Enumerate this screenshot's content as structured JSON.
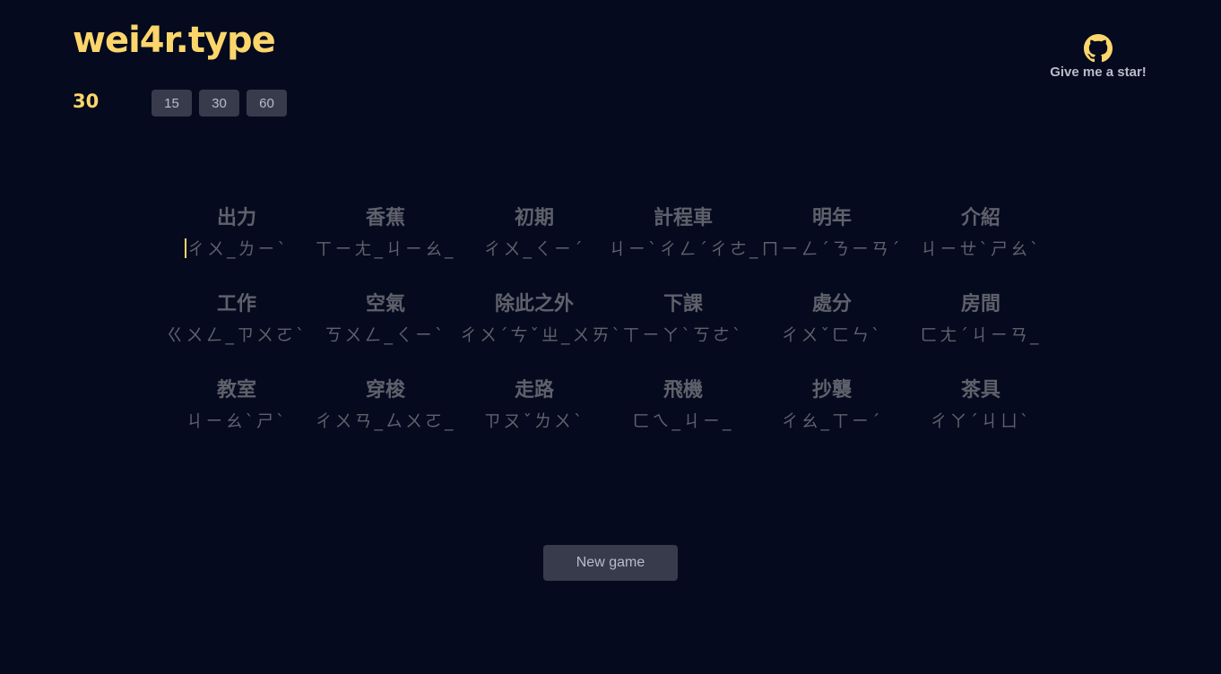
{
  "brand": {
    "title": "wei4r.type"
  },
  "timer": {
    "value": "30"
  },
  "durations": [
    {
      "label": "15"
    },
    {
      "label": "30"
    },
    {
      "label": "60"
    }
  ],
  "github": {
    "icon": "github-icon",
    "label": "Give me a star!"
  },
  "words": [
    {
      "chars": "出力",
      "zhuyin": "ㄔㄨ_ㄌㄧˋ"
    },
    {
      "chars": "香蕉",
      "zhuyin": "ㄒㄧㄤ_ㄐㄧㄠ_"
    },
    {
      "chars": "初期",
      "zhuyin": "ㄔㄨ_ㄑㄧˊ"
    },
    {
      "chars": "計程車",
      "zhuyin": "ㄐㄧˋㄔㄥˊㄔㄜ_"
    },
    {
      "chars": "明年",
      "zhuyin": "ㄇㄧㄥˊㄋㄧㄢˊ"
    },
    {
      "chars": "介紹",
      "zhuyin": "ㄐㄧㄝˋㄕㄠˋ"
    },
    {
      "chars": "工作",
      "zhuyin": "ㄍㄨㄥ_ㄗㄨㄛˋ"
    },
    {
      "chars": "空氣",
      "zhuyin": "ㄎㄨㄥ_ㄑㄧˋ"
    },
    {
      "chars": "除此之外",
      "zhuyin": "ㄔㄨˊㄘˇㄓ_ㄨㄞˋ"
    },
    {
      "chars": "下課",
      "zhuyin": "ㄒㄧㄚˋㄎㄜˋ"
    },
    {
      "chars": "處分",
      "zhuyin": "ㄔㄨˇㄈㄣˋ"
    },
    {
      "chars": "房間",
      "zhuyin": "ㄈㄤˊㄐㄧㄢ_"
    },
    {
      "chars": "教室",
      "zhuyin": "ㄐㄧㄠˋㄕˋ"
    },
    {
      "chars": "穿梭",
      "zhuyin": "ㄔㄨㄢ_ㄙㄨㄛ_"
    },
    {
      "chars": "走路",
      "zhuyin": "ㄗㄡˇㄌㄨˋ"
    },
    {
      "chars": "飛機",
      "zhuyin": "ㄈㄟ_ㄐㄧ_"
    },
    {
      "chars": "抄襲",
      "zhuyin": "ㄔㄠ_ㄒㄧˊ"
    },
    {
      "chars": "茶具",
      "zhuyin": "ㄔㄚˊㄐㄩˋ"
    }
  ],
  "new_game": {
    "label": "New game"
  },
  "colors": {
    "background": "#050a1f",
    "accent": "#fcd66b",
    "muted_text": "#5f616b",
    "button_bg": "#383b4c",
    "button_text": "#b9bcc8"
  }
}
